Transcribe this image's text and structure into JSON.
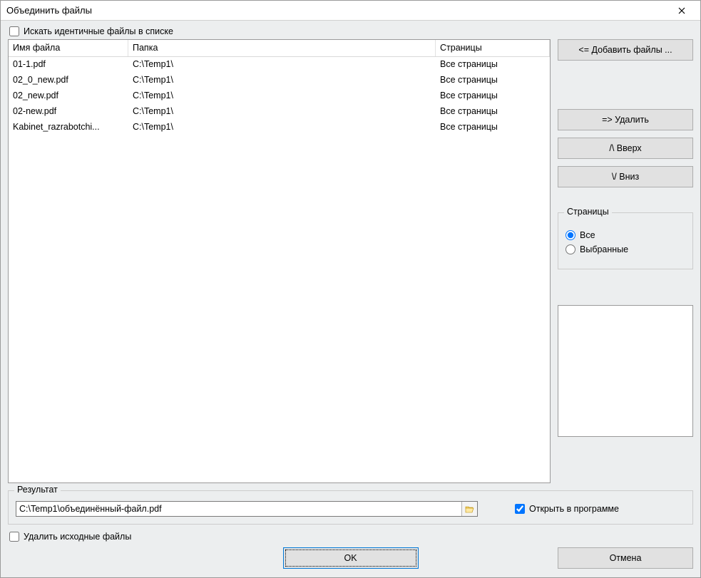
{
  "window": {
    "title": "Объединить файлы"
  },
  "search_identical_label": "Искать идентичные файлы в списке",
  "table": {
    "headers": {
      "file": "Имя файла",
      "folder": "Папка",
      "pages": "Страницы"
    },
    "rows": [
      {
        "file": "01-1.pdf",
        "folder": "C:\\Temp1\\",
        "pages": "Все страницы"
      },
      {
        "file": "02_0_new.pdf",
        "folder": "C:\\Temp1\\",
        "pages": "Все страницы"
      },
      {
        "file": "02_new.pdf",
        "folder": "C:\\Temp1\\",
        "pages": "Все страницы"
      },
      {
        "file": "02-new.pdf",
        "folder": "C:\\Temp1\\",
        "pages": "Все страницы"
      },
      {
        "file": "Kabinet_razrabotchi...",
        "folder": "C:\\Temp1\\",
        "pages": "Все страницы"
      }
    ]
  },
  "side": {
    "add": "<= Добавить файлы ...",
    "remove": "=> Удалить",
    "up": "/\\  Вверх",
    "down": "\\/  Вниз",
    "pages_group": "Страницы",
    "pages_all": "Все",
    "pages_selected": "Выбранные"
  },
  "result": {
    "label": "Результат",
    "path": "C:\\Temp1\\объединённый-файл.pdf",
    "open_label": "Открыть в программе"
  },
  "delete_source_label": "Удалить исходные файлы",
  "buttons": {
    "ok": "OK",
    "cancel": "Отмена"
  }
}
